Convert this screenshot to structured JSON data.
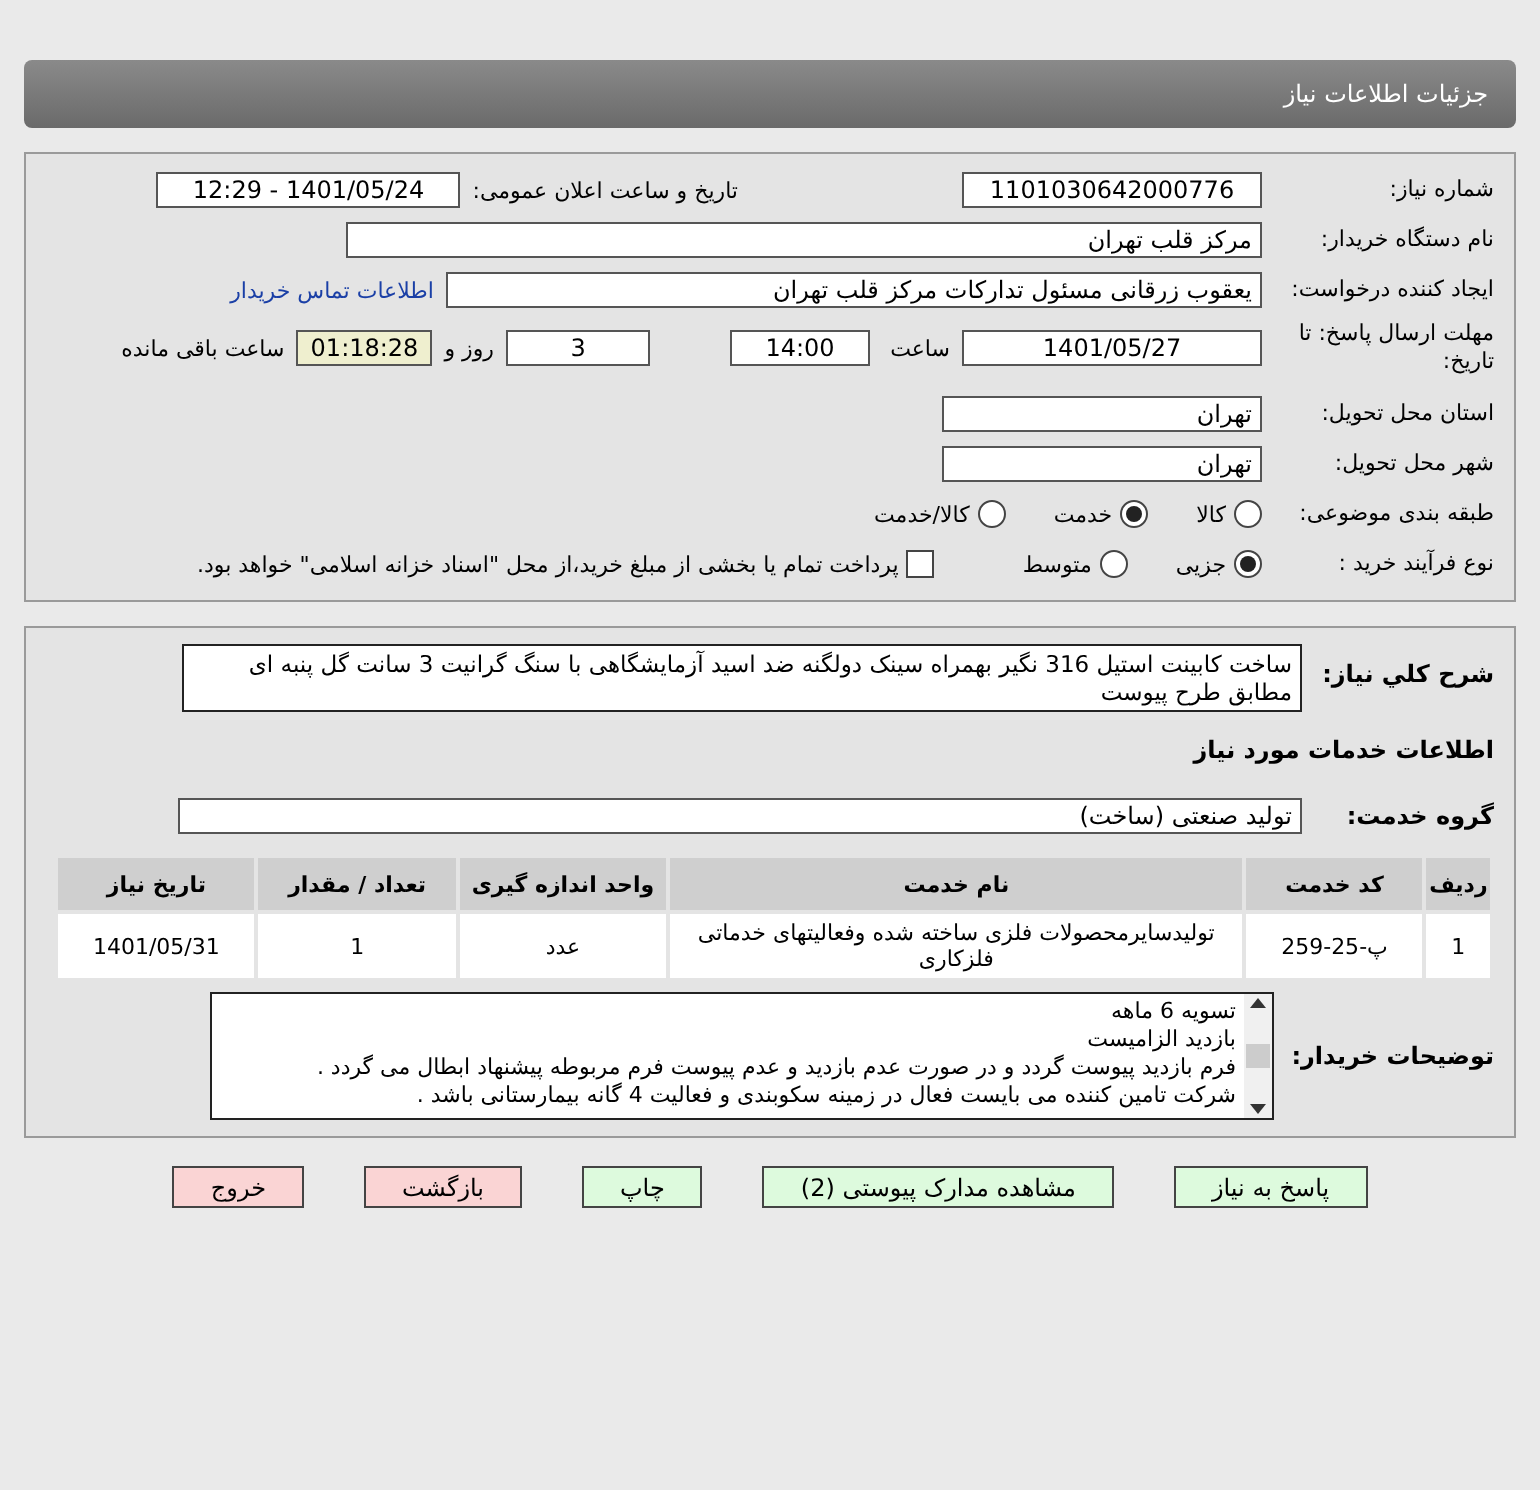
{
  "header": {
    "title": "جزئیات اطلاعات نیاز"
  },
  "need_number": {
    "label": "شماره نیاز:",
    "value": "1101030642000776"
  },
  "announce": {
    "label": "تاریخ و ساعت اعلان عمومی:",
    "value": "1401/05/24 - 12:29"
  },
  "buyer_org": {
    "label": "نام دستگاه خریدار:",
    "value": "مرکز قلب تهران"
  },
  "requester": {
    "label": "ایجاد کننده درخواست:",
    "value": "یعقوب زرقانی مسئول تدارکات مرکز قلب تهران",
    "link": "اطلاعات تماس خریدار"
  },
  "deadline": {
    "label": "مهلت ارسال پاسخ: تا تاریخ:",
    "date": "1401/05/27",
    "time_label": "ساعت",
    "time": "14:00",
    "days": "3",
    "days_label": "روز و",
    "remaining": "01:18:28",
    "remaining_label": "ساعت باقی مانده"
  },
  "province": {
    "label": "استان محل تحویل:",
    "value": "تهران"
  },
  "city": {
    "label": "شهر محل تحویل:",
    "value": "تهران"
  },
  "category": {
    "label": "طبقه بندی موضوعی:",
    "options": [
      {
        "label": "کالا",
        "selected": false
      },
      {
        "label": "خدمت",
        "selected": true
      },
      {
        "label": "کالا/خدمت",
        "selected": false
      }
    ]
  },
  "process": {
    "label": "نوع فرآیند خرید :",
    "options": [
      {
        "label": "جزیی",
        "selected": true
      },
      {
        "label": "متوسط",
        "selected": false
      }
    ],
    "payment": {
      "checked": false,
      "label": "پرداخت تمام یا بخشی از مبلغ خرید،از محل \"اسناد خزانه اسلامی\" خواهد بود."
    }
  },
  "description": {
    "label": "شرح کلي نياز:",
    "value": "ساخت کابینت استیل 316 نگیر بهمراه سینک دولگنه ضد اسید آزمایشگاهی با سنگ گرانیت 3 سانت گل پنبه ای مطابق طرح پیوست"
  },
  "services_heading": "اطلاعات خدمات مورد نیاز",
  "service_group": {
    "label": "گروه خدمت:",
    "value": "تولید صنعتی (ساخت)"
  },
  "table": {
    "columns": [
      "ردیف",
      "کد خدمت",
      "نام خدمت",
      "واحد اندازه گیری",
      "تعداد / مقدار",
      "تاریخ نیاز"
    ],
    "rows": [
      [
        "1",
        "پ-25-259",
        "تولیدسایرمحصولات فلزی ساخته شده وفعالیتهای خدماتی فلزکاری",
        "عدد",
        "1",
        "1401/05/31"
      ]
    ]
  },
  "notes": {
    "label": "توضیحات خریدار:",
    "lines": [
      "تسویه 6 ماهه",
      "بازدید الزامیست",
      "فرم بازدید پیوست گردد و در صورت عدم بازدید و عدم پیوست فرم مربوطه پیشنهاد ابطال می گردد .",
      "شرکت تامین کننده می بایست فعال در زمینه سکوبندی و فعالیت 4 گانه بیمارستانی باشد ."
    ]
  },
  "buttons": [
    {
      "label": "پاسخ به نیاز",
      "color": "#ddfadd"
    },
    {
      "label": "مشاهده مدارک پیوستی (2)",
      "color": "#ddfadd"
    },
    {
      "label": "چاپ",
      "color": "#ddfadd"
    },
    {
      "label": "بازگشت",
      "color": "#fad4d4"
    },
    {
      "label": "خروج",
      "color": "#fad4d4"
    }
  ]
}
